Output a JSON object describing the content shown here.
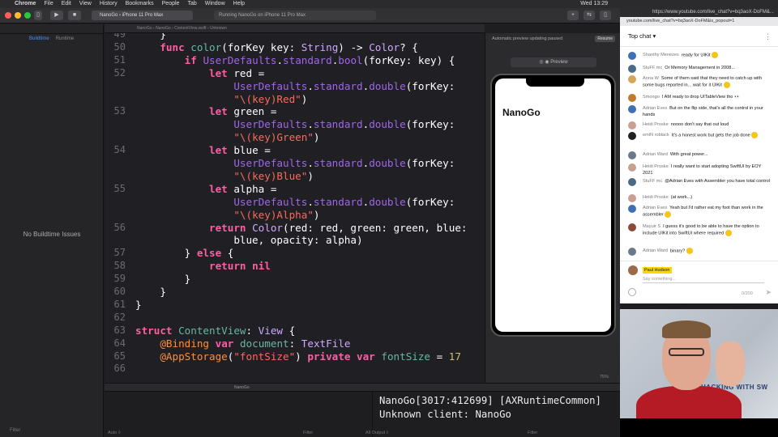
{
  "menubar": {
    "app": "Chrome",
    "items": [
      "File",
      "Edit",
      "View",
      "History",
      "Bookmarks",
      "People",
      "Tab",
      "Window",
      "Help"
    ],
    "clock": "Wed 13:29"
  },
  "toolbar": {
    "scheme": "NanoGo  ›  iPhone 11 Pro Max",
    "activity": "Running NanoGo on iPhone 11 Pro Max"
  },
  "navigator": {
    "tabs": [
      "Buildtime",
      "Runtime"
    ],
    "empty_message": "No Buildtime Issues",
    "filter_placeholder": "Filter"
  },
  "jumpbar": {
    "path": "NanoGo  ›  NanoGo  ›  ContentView.swift  ›  Unknown"
  },
  "editor": {
    "lines": [
      {
        "n": "49",
        "code": "    }"
      },
      {
        "n": "50",
        "code": "    func color(forKey key: String) -> Color? {"
      },
      {
        "n": "51",
        "code": "        if UserDefaults.standard.bool(forKey: key) {"
      },
      {
        "n": "52",
        "code": "            let red ="
      },
      {
        "n": "",
        "code": "                UserDefaults.standard.double(forKey:"
      },
      {
        "n": "",
        "code": "                \"\\(key)Red\")"
      },
      {
        "n": "53",
        "code": "            let green ="
      },
      {
        "n": "",
        "code": "                UserDefaults.standard.double(forKey:"
      },
      {
        "n": "",
        "code": "                \"\\(key)Green\")"
      },
      {
        "n": "54",
        "code": "            let blue ="
      },
      {
        "n": "",
        "code": "                UserDefaults.standard.double(forKey:"
      },
      {
        "n": "",
        "code": "                \"\\(key)Blue\")"
      },
      {
        "n": "55",
        "code": "            let alpha ="
      },
      {
        "n": "",
        "code": "                UserDefaults.standard.double(forKey:"
      },
      {
        "n": "",
        "code": "                \"\\(key)Alpha\")"
      },
      {
        "n": "56",
        "code": "            return Color(red: red, green: green, blue:"
      },
      {
        "n": "",
        "code": "                blue, opacity: alpha)"
      },
      {
        "n": "57",
        "code": "        } else {"
      },
      {
        "n": "58",
        "code": "            return nil"
      },
      {
        "n": "59",
        "code": "        }"
      },
      {
        "n": "60",
        "code": "    }"
      },
      {
        "n": "61",
        "code": "}"
      },
      {
        "n": "62",
        "code": ""
      },
      {
        "n": "63",
        "code": "struct ContentView: View {"
      },
      {
        "n": "64",
        "code": "    @Binding var document: TextFile"
      },
      {
        "n": "65",
        "code": "    @AppStorage(\"fontSize\") private var fontSize = 17"
      },
      {
        "n": "66",
        "code": ""
      }
    ]
  },
  "preview": {
    "status": "Automatic preview updating paused",
    "resume_label": "Resume",
    "control_label": "Preview",
    "app_title": "NanoGo",
    "zoom": "75%"
  },
  "debug": {
    "target": "NanoGo",
    "scope": "Auto ◊",
    "output_filter": "All Output ◊",
    "filter_placeholder": "Filter"
  },
  "console": {
    "output": "NanoGo[3017:412699] [AXRuntimeCommon]\nUnknown client: NanoGo"
  },
  "chrome": {
    "tab_url": "https://www.youtube.com/live_chat?v=bq3aoX-DoFM&...",
    "url": "youtube.com/live_chat?v=bq3aoX-DoFM&is_popout=1"
  },
  "chat": {
    "header": "Top chat",
    "messages": [
      {
        "author": "Shanthy Menezes",
        "text": "ready for UIKit",
        "color": "#3f6fb5",
        "emoji": true
      },
      {
        "author": "StuFF mc",
        "text": "Or Memory Management in 2008...",
        "color": "#4b6a88",
        "emoji": false
      },
      {
        "author": "Anna W",
        "text": "Some of them said that they need to catch up with some bugs reported in... wait for it UIKit",
        "color": "#d8a45a",
        "emoji": true
      },
      {
        "author": "Smongo",
        "text": "I AM ready to drop UITableView tho 👀",
        "color": "#c07a2e",
        "emoji": false
      },
      {
        "author": "Adrian Eves",
        "text": "But on the flip side, that's all the control in your hands",
        "color": "#3f6fb5",
        "emoji": false
      },
      {
        "author": "Heidi Proske",
        "text": "noooo don't say that out loud",
        "color": "#c8a090",
        "emoji": false
      },
      {
        "author": "emiN roblack",
        "text": "It's a honest work but gets the job done",
        "color": "#222222",
        "emoji": true
      },
      {
        "author": "Adrian Ward",
        "text": "With great power...",
        "color": "#6a7a8a",
        "emoji": false
      },
      {
        "author": "Heidi Proske",
        "text": "I really want to start adopting SwiftUI by EOY 2021",
        "color": "#c8a090",
        "emoji": false
      },
      {
        "author": "StuFF mc",
        "text": "@Adrian Eves with Assembler you have total control",
        "color": "#4b6a88",
        "emoji": false
      },
      {
        "author": "Heidi Proske",
        "text": "(at work...)",
        "color": "#c8a090",
        "emoji": false
      },
      {
        "author": "Adrian Eves",
        "text": "Yeah but I'd rather eat my foot than work in the assembler",
        "color": "#3f6fb5",
        "emoji": true
      },
      {
        "author": "Mayuir S",
        "text": "I guess it's good to be able to have the option to include UIKit into SwiftUI where required",
        "color": "#8a4a3a",
        "emoji": true
      },
      {
        "author": "Adrian Ward",
        "text": "binary?",
        "color": "#6a7a8a",
        "emoji": true
      }
    ],
    "me": "Paul Hudson",
    "placeholder": "Say something...",
    "char_count": "0/200"
  },
  "webcam": {
    "sign": "HACKING WITH SW"
  },
  "colors": {
    "keyword": "#fc5fa3",
    "function": "#67b7a4",
    "type": "#d0a8ff",
    "string": "#fc6a5d",
    "number": "#d0bf69",
    "accent": "#4a90ff"
  }
}
